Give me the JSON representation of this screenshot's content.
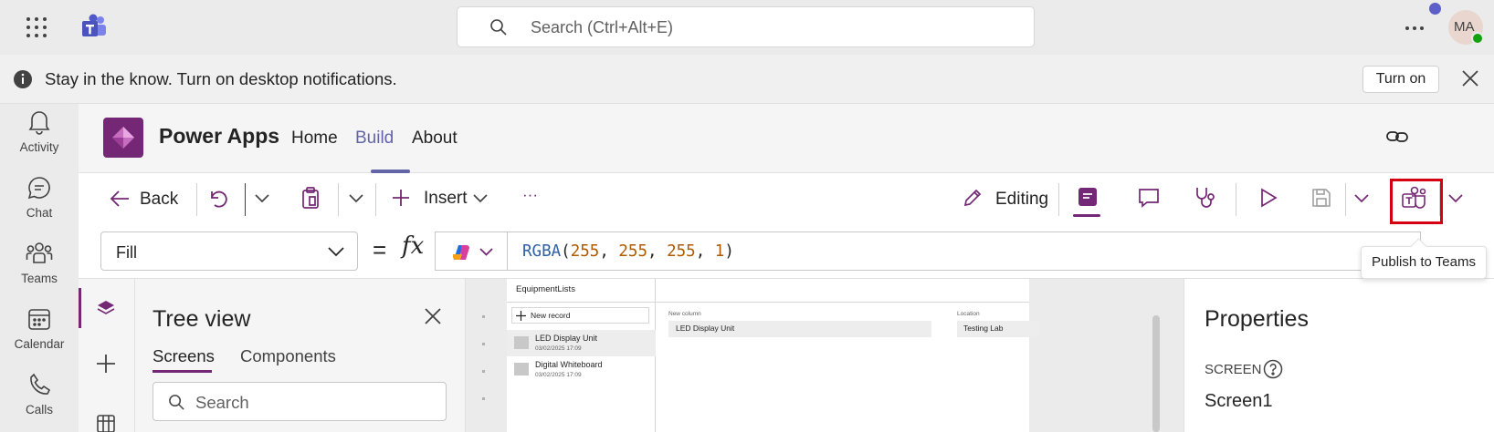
{
  "teams": {
    "search_placeholder": "Search (Ctrl+Alt+E)",
    "avatar_initials": "MA"
  },
  "notification": {
    "message": "Stay in the know. Turn on desktop notifications.",
    "turn_on_label": "Turn on"
  },
  "rail": {
    "items": [
      {
        "label": "Activity",
        "icon": "bell-icon"
      },
      {
        "label": "Chat",
        "icon": "chat-icon"
      },
      {
        "label": "Teams",
        "icon": "teams-icon"
      },
      {
        "label": "Calendar",
        "icon": "calendar-icon"
      },
      {
        "label": "Calls",
        "icon": "phone-icon"
      }
    ]
  },
  "app": {
    "name": "Power Apps",
    "nav": [
      {
        "label": "Home",
        "active": false
      },
      {
        "label": "Build",
        "active": true
      },
      {
        "label": "About",
        "active": false
      }
    ]
  },
  "toolbar": {
    "back_label": "Back",
    "insert_label": "Insert",
    "more_label": "···",
    "editing_label": "Editing",
    "publish_tooltip": "Publish to Teams"
  },
  "formula": {
    "property": "Fill",
    "fx": "fx",
    "func": "RGBA",
    "args": [
      "255",
      "255",
      "255",
      "1"
    ]
  },
  "tree": {
    "title": "Tree view",
    "tabs": [
      "Screens",
      "Components"
    ],
    "search_placeholder": "Search"
  },
  "canvas": {
    "gallery_title": "EquipmentLists",
    "new_record_label": "New record",
    "records": [
      {
        "title": "LED Display Unit",
        "date": "03/02/2025 17:09"
      },
      {
        "title": "Digital Whiteboard",
        "date": "03/02/2025 17:09"
      }
    ],
    "form": {
      "col1_label": "New column",
      "col1_value": "LED Display Unit",
      "col2_label": "Location",
      "col2_value": "Testing Lab"
    }
  },
  "properties": {
    "title": "Properties",
    "screen_label": "SCREEN",
    "screen_name": "Screen1"
  },
  "colors": {
    "teams_purple": "#6264a7",
    "powerapps_purple": "#742774",
    "highlight_red": "#d40012"
  }
}
